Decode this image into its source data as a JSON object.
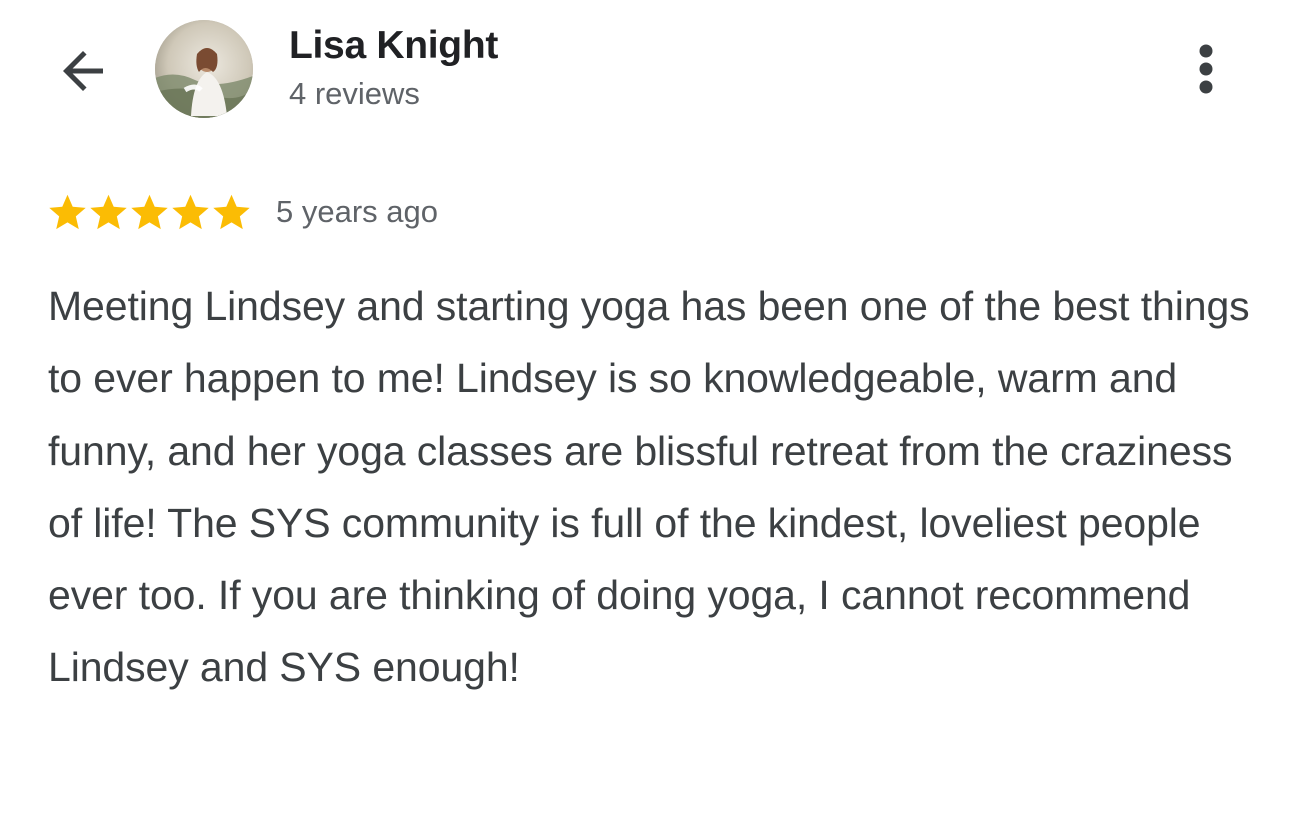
{
  "header": {
    "back_icon": "arrow-back-icon",
    "reviewer_name": "Lisa Knight",
    "review_count": "4 reviews",
    "more_icon": "more-vert-icon"
  },
  "review": {
    "rating": 5,
    "rating_max": 5,
    "star_color": "#fbbc04",
    "date": "5 years ago",
    "text": "Meeting Lindsey and starting yoga has been one of the best things to ever happen to me! Lindsey is so knowledgeable, warm and funny, and her yoga classes are blissful retreat from the craziness of life! The SYS community is full of the kindest, loveliest people ever too. If you are thinking of doing yoga, I cannot recommend Lindsey and SYS enough!"
  }
}
